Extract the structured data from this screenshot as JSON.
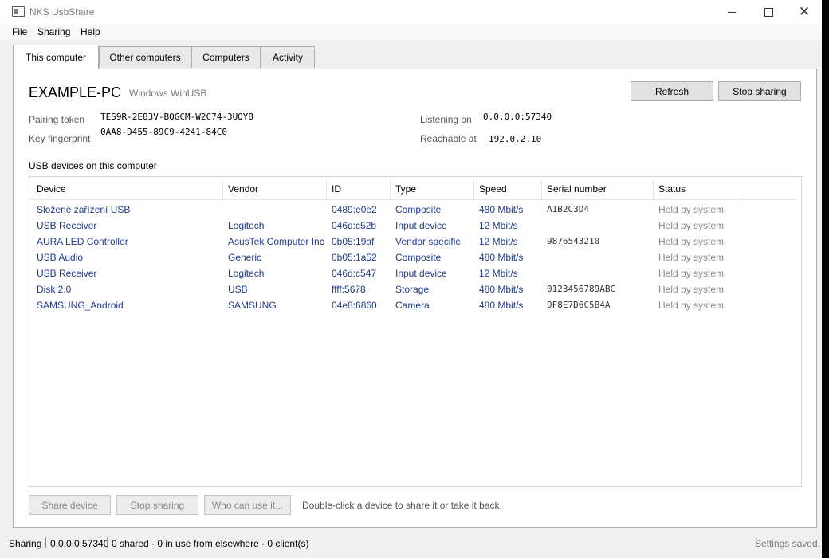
{
  "window": {
    "title": "NKS UsbShare",
    "app_icon": "usb-share-app-icon"
  },
  "menu": [
    "File",
    "Sharing",
    "Help"
  ],
  "tabs": [
    "This computer",
    "Other computers",
    "Computers",
    "Activity"
  ],
  "active_tab": "This computer",
  "host": {
    "name": "EXAMPLE-PC",
    "driver": "Windows WinUSB",
    "pairing_token_label": "Pairing token",
    "pairing_token": "TES9R-2E83V-BQGCM-W2C74-3UQY8",
    "key_fingerprint_label": "Key fingerprint",
    "key_fingerprint": "0AA8-D455-89C9-4241-84C0",
    "listening_on_label": "Listening on",
    "listening_on": "0.0.0.0:57340",
    "reachable_at_label": "Reachable at",
    "reachable_at": "192.0.2.10"
  },
  "actions": {
    "refresh": "Refresh",
    "stop_sharing": "Stop sharing"
  },
  "devices": {
    "section_title": "USB devices on this computer",
    "columns": [
      "Device",
      "Vendor",
      "ID",
      "Type",
      "Speed",
      "Serial number",
      "Status"
    ],
    "rows": [
      {
        "device": "Složené zařízení USB",
        "vendor": "",
        "id": "0489:e0e2",
        "type": "Composite",
        "speed": "480 Mbit/s",
        "serial": "A1B2C3D4",
        "status": "Held by system"
      },
      {
        "device": "USB Receiver",
        "vendor": "Logitech",
        "id": "046d:c52b",
        "type": "Input device",
        "speed": "12 Mbit/s",
        "serial": "",
        "status": "Held by system"
      },
      {
        "device": "AURA LED Controller",
        "vendor": "AsusTek Computer Inc",
        "id": "0b05:19af",
        "type": "Vendor specific",
        "speed": "12 Mbit/s",
        "serial": "9876543210",
        "status": "Held by system"
      },
      {
        "device": "USB Audio",
        "vendor": "Generic",
        "id": "0b05:1a52",
        "type": "Composite",
        "speed": "480 Mbit/s",
        "serial": "",
        "status": "Held by system"
      },
      {
        "device": "USB Receiver",
        "vendor": "Logitech",
        "id": "046d:c547",
        "type": "Input device",
        "speed": "12 Mbit/s",
        "serial": "",
        "status": "Held by system"
      },
      {
        "device": "Disk 2.0",
        "vendor": "USB",
        "id": "ffff:5678",
        "type": "Storage",
        "speed": "480 Mbit/s",
        "serial": "0123456789ABC",
        "status": "Held by system"
      },
      {
        "device": "SAMSUNG_Android",
        "vendor": "SAMSUNG",
        "id": "04e8:6860",
        "type": "Camera",
        "speed": "480 Mbit/s",
        "serial": "9F8E7D6C5B4A",
        "status": "Held by system"
      }
    ]
  },
  "bottom_actions": {
    "share_device": "Share device",
    "stop_sharing": "Stop sharing",
    "who_can_use": "Who can use it...",
    "hint": "Double-click a device to share it or take it back."
  },
  "statusbar": {
    "state": "Sharing",
    "endpoint": "0.0.0.0:57340",
    "summary": "0 shared · 0 in use from elsewhere · 0 client(s)",
    "right": "Settings saved."
  }
}
